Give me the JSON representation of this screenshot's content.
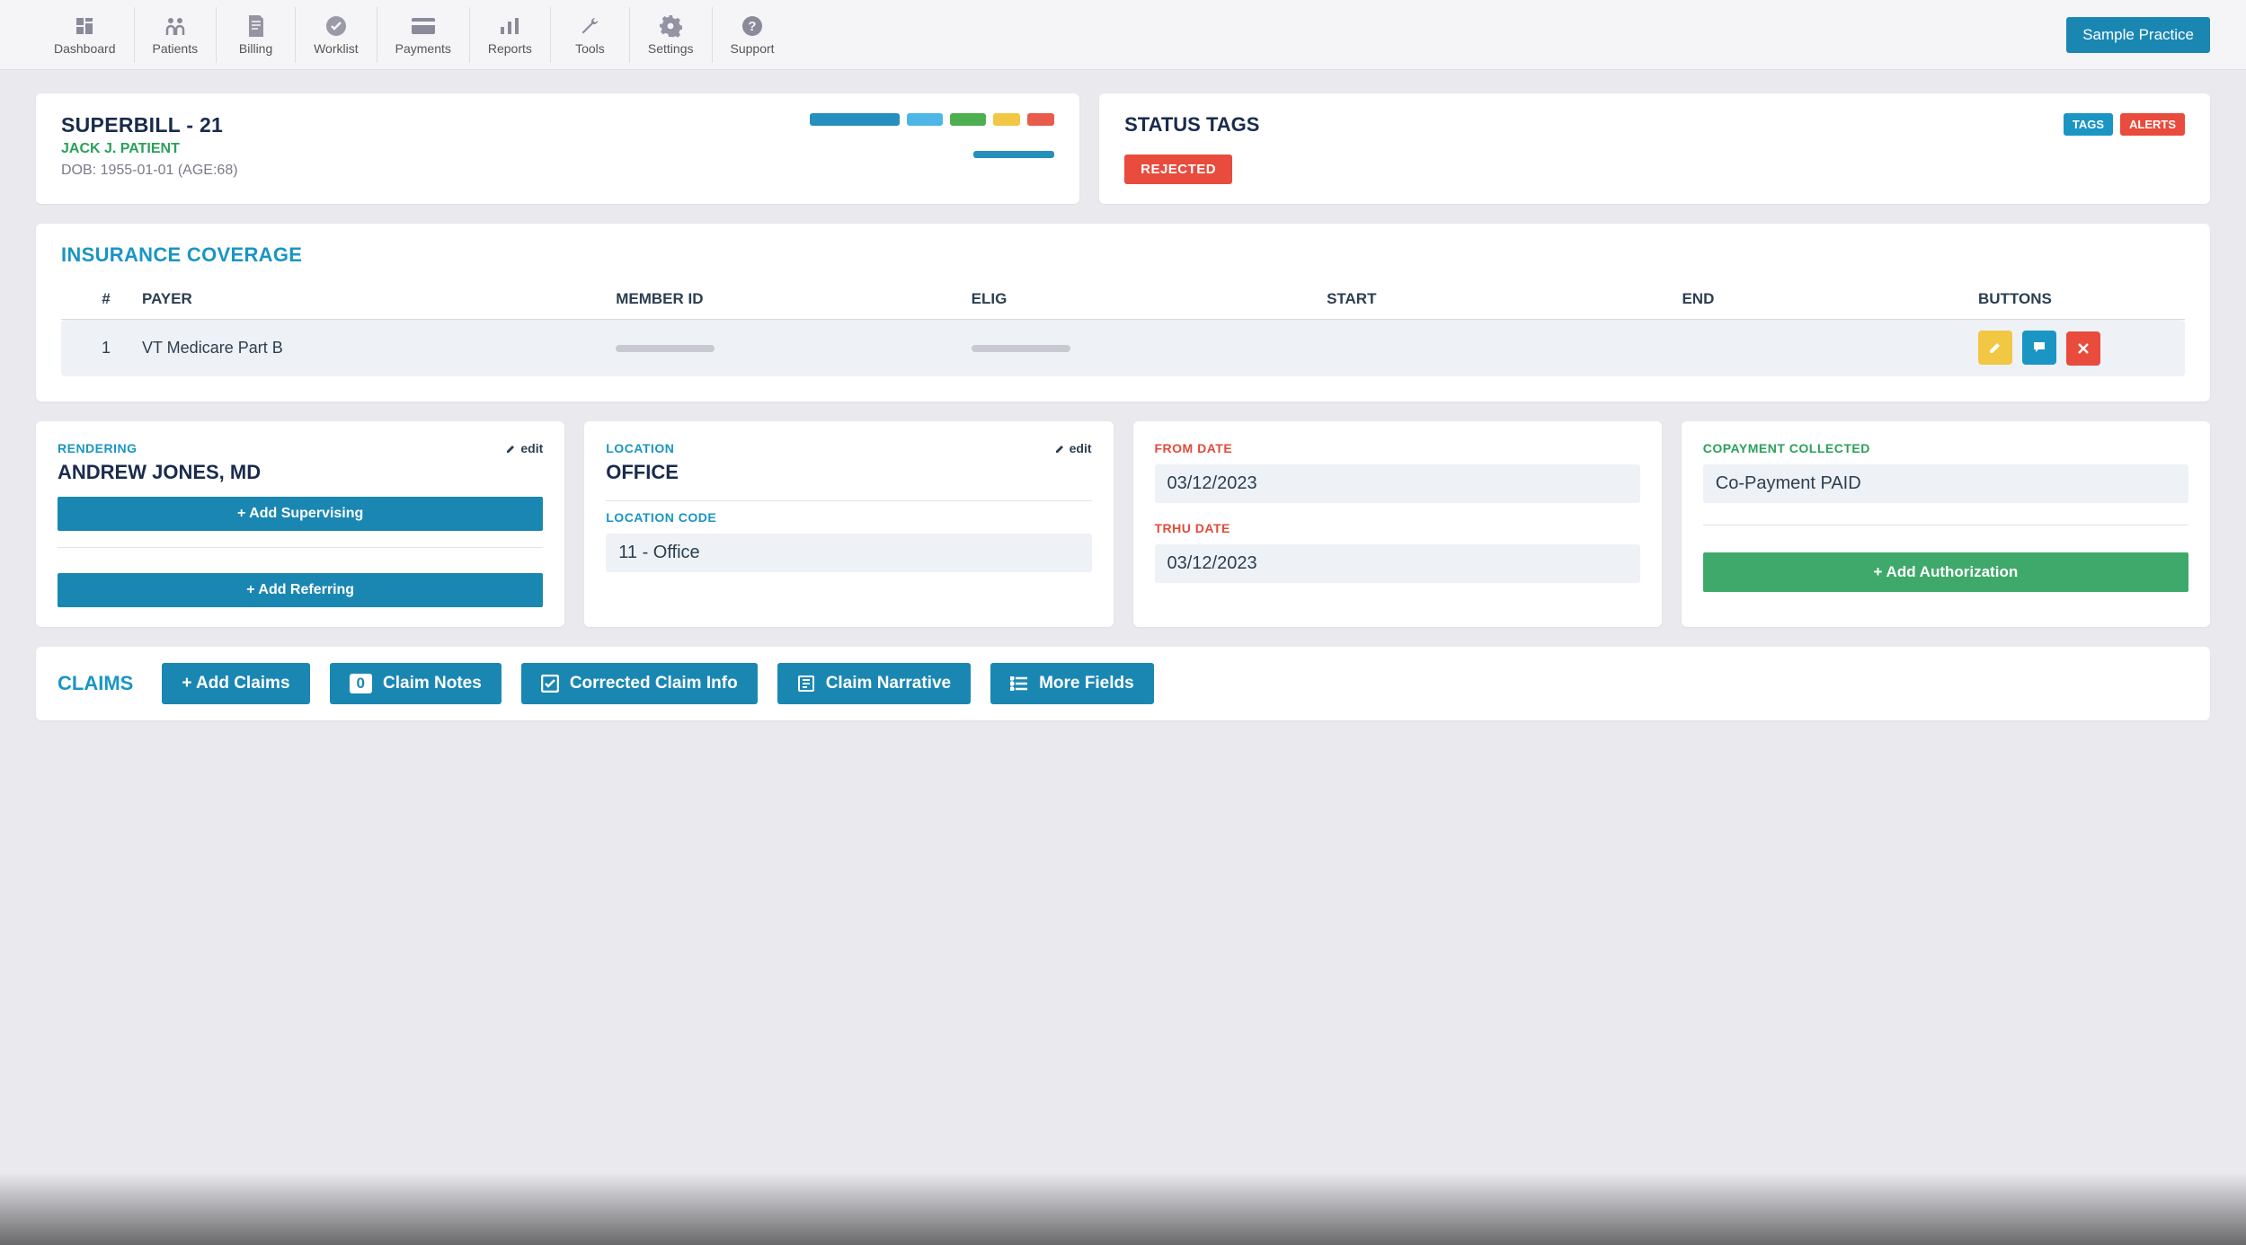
{
  "nav": {
    "items": [
      {
        "label": "Dashboard",
        "icon": "dashboard-icon"
      },
      {
        "label": "Patients",
        "icon": "patients-icon"
      },
      {
        "label": "Billing",
        "icon": "billing-icon"
      },
      {
        "label": "Worklist",
        "icon": "worklist-icon"
      },
      {
        "label": "Payments",
        "icon": "payments-icon"
      },
      {
        "label": "Reports",
        "icon": "reports-icon"
      },
      {
        "label": "Tools",
        "icon": "tools-icon"
      },
      {
        "label": "Settings",
        "icon": "settings-icon"
      },
      {
        "label": "Support",
        "icon": "support-icon"
      }
    ],
    "sample_label": "Sample Practice"
  },
  "superbill": {
    "title": "SUPERBILL - 21",
    "patient": "JACK J. PATIENT",
    "dob": "DOB: 1955-01-01 (AGE:68)"
  },
  "status": {
    "title": "STATUS TAGS",
    "tags_btn": "TAGS",
    "alerts_btn": "ALERTS",
    "badge": "REJECTED"
  },
  "insurance": {
    "title": "INSURANCE COVERAGE",
    "cols": {
      "num": "#",
      "payer": "PAYER",
      "member": "MEMBER ID",
      "elig": "ELIG",
      "start": "START",
      "end": "END",
      "buttons": "BUTTONS"
    },
    "rows": [
      {
        "num": "1",
        "payer": "VT Medicare Part B",
        "member": "",
        "elig": "",
        "start": "",
        "end": ""
      }
    ]
  },
  "rendering": {
    "label": "RENDERING",
    "value": "ANDREW JONES, MD",
    "edit": "edit",
    "add_supervising": "+ Add Supervising",
    "add_referring": "+ Add Referring"
  },
  "location": {
    "label": "LOCATION",
    "value": "OFFICE",
    "edit": "edit",
    "code_label": "LOCATION CODE",
    "code_value": "11 - Office"
  },
  "dates": {
    "from_label": "FROM DATE",
    "from_value": "03/12/2023",
    "thru_label": "TRHU DATE",
    "thru_value": "03/12/2023"
  },
  "copay": {
    "label": "COPAYMENT COLLECTED",
    "value": "Co-Payment PAID",
    "add_auth": "+ Add Authorization"
  },
  "claims": {
    "title": "CLAIMS",
    "add": "+ Add Claims",
    "notes_count": "0",
    "notes": "Claim Notes",
    "corrected": "Corrected Claim Info",
    "narrative": "Claim Narrative",
    "more": "More Fields"
  }
}
